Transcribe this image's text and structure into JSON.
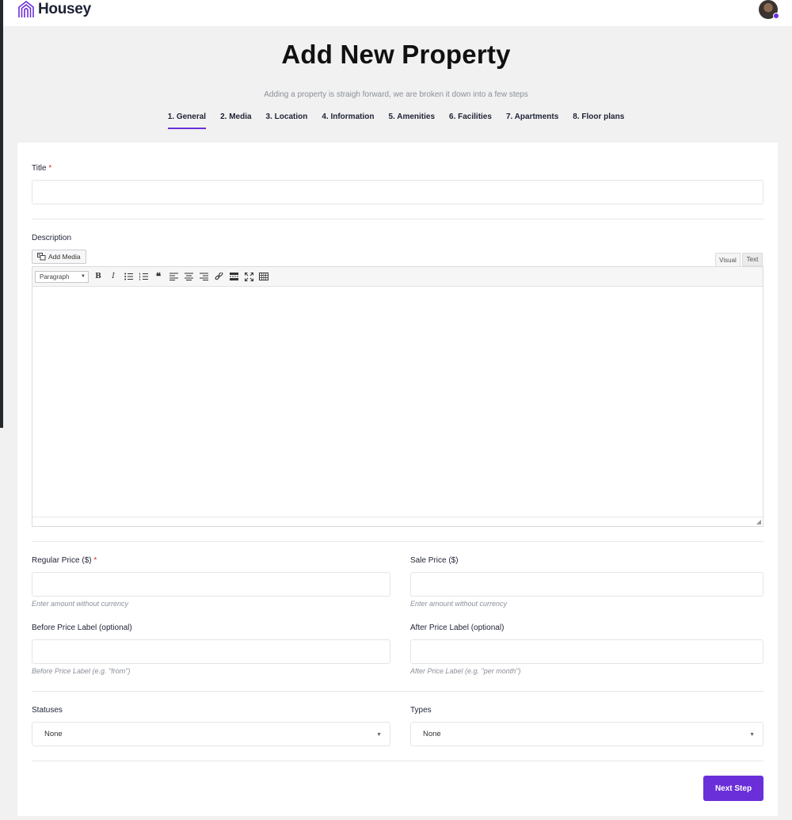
{
  "header": {
    "logo_text": "Housey",
    "logo_icon": "house-lines-icon",
    "avatar": "user-avatar",
    "avatar_status_color": "#6b2fd9"
  },
  "page": {
    "title": "Add New Property",
    "subtitle": "Adding a property is straigh forward, we are broken it down into a few steps"
  },
  "steps": [
    {
      "label": "1. General",
      "active": true
    },
    {
      "label": "2. Media",
      "active": false
    },
    {
      "label": "3. Location",
      "active": false
    },
    {
      "label": "4. Information",
      "active": false
    },
    {
      "label": "5. Amenities",
      "active": false
    },
    {
      "label": "6. Facilities",
      "active": false
    },
    {
      "label": "7. Apartments",
      "active": false
    },
    {
      "label": "8. Floor plans",
      "active": false
    }
  ],
  "form": {
    "title_label": "Title",
    "title_value": "",
    "required_mark": "*",
    "description_label": "Description",
    "add_media_label": "Add Media",
    "visual_tab": "Visual",
    "text_tab": "Text",
    "format_select": "Paragraph",
    "toolbar_icons": [
      "bold-icon",
      "italic-icon",
      "bullet-list-icon",
      "numbered-list-icon",
      "blockquote-icon",
      "align-left-icon",
      "align-center-icon",
      "align-right-icon",
      "link-icon",
      "read-more-icon",
      "fullscreen-icon",
      "toolbar-toggle-icon"
    ],
    "regular_price_label": "Regular Price ($)",
    "regular_price_hint": "Enter amount without currency",
    "sale_price_label": "Sale Price ($)",
    "sale_price_hint": "Enter amount without currency",
    "before_price_label": "Before Price Label (optional)",
    "before_price_hint": "Before Price Label (e.g. \"from\")",
    "after_price_label": "After Price Label (optional)",
    "after_price_hint": "After Price Label (e.g. \"per month\")",
    "statuses_label": "Statuses",
    "statuses_value": "None",
    "types_label": "Types",
    "types_value": "None",
    "next_button": "Next Step"
  },
  "colors": {
    "accent": "#6b2fd9",
    "required": "#d42f2f",
    "background": "#f1f1f1"
  }
}
